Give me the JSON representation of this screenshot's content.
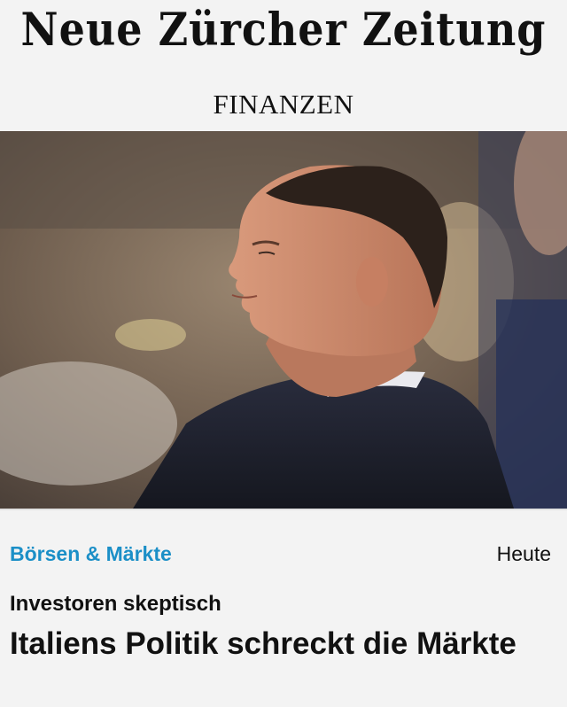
{
  "masthead": {
    "logo_text": "Neue Zürcher Zeitung",
    "section": "FINANZEN"
  },
  "article": {
    "image_alt": "Porträt eines Mannes im dunklen Anzug im Profil",
    "category": "Börsen & Märkte",
    "date": "Heute",
    "kicker": "Investoren skeptisch",
    "headline": "Italiens Politik schreckt die Märkte"
  },
  "colors": {
    "background": "#f3f3f3",
    "category_link": "#1b8fc7",
    "text": "#111111"
  }
}
